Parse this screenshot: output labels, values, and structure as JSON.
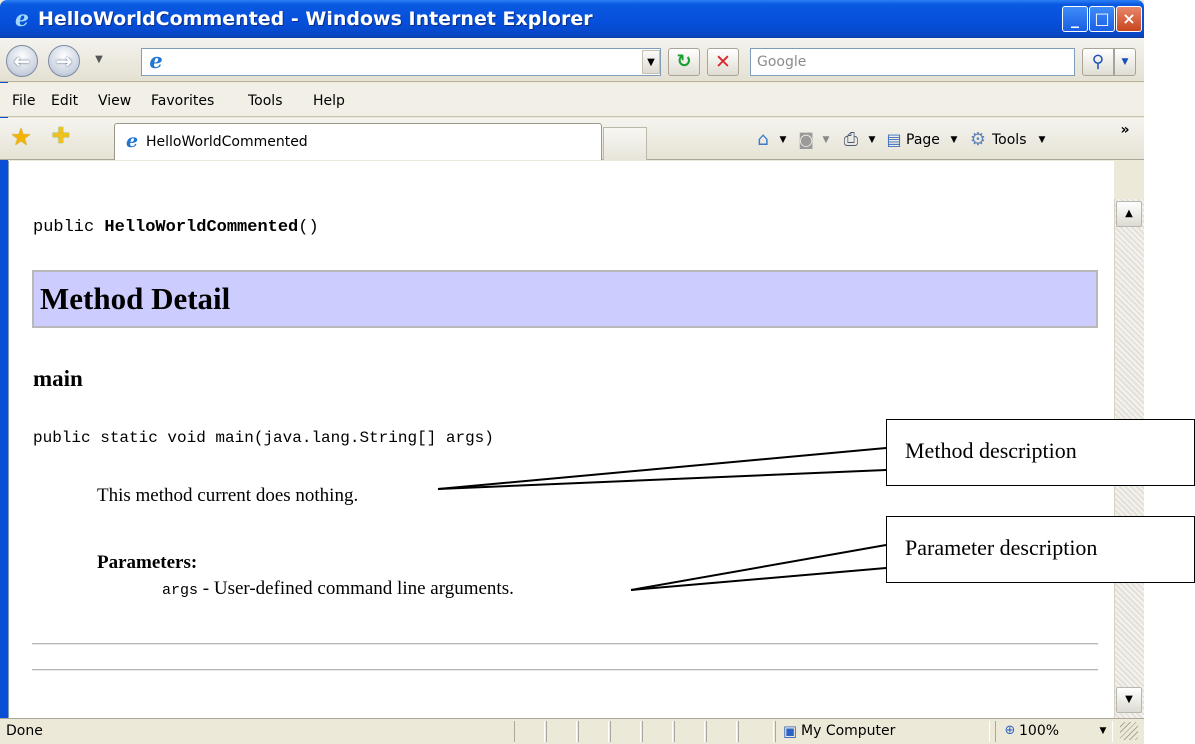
{
  "window": {
    "title": "HelloWorldCommented - Windows Internet Explorer",
    "controls": {
      "minimize": "_",
      "maximize": "□",
      "close": "×"
    }
  },
  "toolbar": {
    "address_value": "",
    "search_placeholder": "Google"
  },
  "menu": [
    "File",
    "Edit",
    "View",
    "Favorites",
    "Tools",
    "Help"
  ],
  "tabs": [
    {
      "label": "HelloWorldCommented",
      "active": true
    }
  ],
  "command_bar": {
    "page_label": "Page",
    "tools_label": "Tools"
  },
  "page": {
    "constructor_prefix": "public ",
    "constructor_name": "HelloWorldCommented",
    "constructor_suffix": "()",
    "section_title": "Method Detail",
    "method_name": "main",
    "method_signature": "public static void main(java.lang.String[] args)",
    "method_description": "This method current does nothing.",
    "parameters_heading": "Parameters:",
    "param_name": "args",
    "param_description": " - User-defined command line arguments."
  },
  "status": {
    "text": "Done",
    "zone": "My Computer",
    "zoom": "100%"
  },
  "annotations": {
    "method_description": "Method description",
    "parameter_description": "Parameter description"
  },
  "colors": {
    "title_bar": "#0550dc",
    "section_bg": "#ccccff",
    "chrome": "#ece9d8"
  }
}
